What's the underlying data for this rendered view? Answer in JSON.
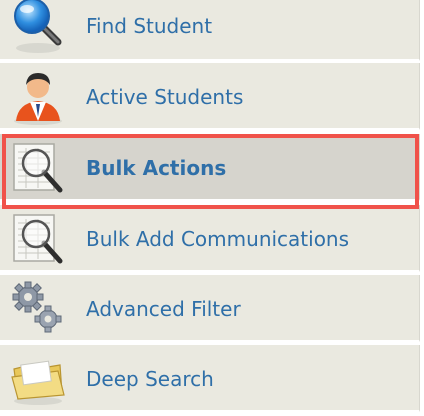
{
  "menu": {
    "items": [
      {
        "label": "Find Student",
        "icon": "magnifier-icon"
      },
      {
        "label": "Active Students",
        "icon": "person-icon"
      },
      {
        "label": "Bulk Actions",
        "icon": "document-search-icon",
        "selected": true
      },
      {
        "label": "Bulk Add Communications",
        "icon": "document-search-icon"
      },
      {
        "label": "Advanced Filter",
        "icon": "gears-icon"
      },
      {
        "label": "Deep Search",
        "icon": "folder-search-icon"
      }
    ]
  },
  "colors": {
    "item_bg": "#eae9e0",
    "selected_bg": "#d6d4cd",
    "label": "#2f6fa8",
    "highlight": "#f0524a"
  }
}
